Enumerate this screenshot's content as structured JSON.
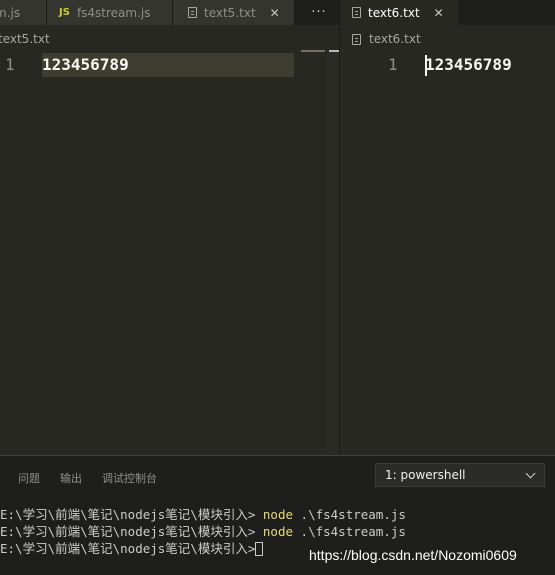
{
  "tabs_left": [
    {
      "label": "m.js",
      "type": "plain",
      "active": false
    },
    {
      "label": "fs4stream.js",
      "badge": "JS",
      "active": false
    },
    {
      "label": "text5.txt",
      "active": false,
      "close": "✕"
    }
  ],
  "more_label": "···",
  "tabs_right": [
    {
      "label": "text6.txt",
      "active": true,
      "close": "✕"
    }
  ],
  "left_editor": {
    "breadcrumb": "text5.txt",
    "line_number": "1",
    "content": "123456789"
  },
  "right_editor": {
    "breadcrumb": "text6.txt",
    "line_number": "1",
    "content": "123456789"
  },
  "panel": {
    "tabs": [
      "问题",
      "输出",
      "调试控制台"
    ],
    "terminal_select": "1: powershell",
    "lines": [
      {
        "prompt": "E:\\学习\\前端\\笔记\\nodejs笔记\\模块引入>",
        "cmd": "node",
        "args": ".\\fs4stream.js"
      },
      {
        "prompt": "E:\\学习\\前端\\笔记\\nodejs笔记\\模块引入>",
        "cmd": "node",
        "args": ".\\fs4stream.js"
      },
      {
        "prompt": "E:\\学习\\前端\\笔记\\nodejs笔记\\模块引入>",
        "cmd": "",
        "args": ""
      }
    ]
  },
  "watermark": "https://blog.csdn.net/Nozomi0609",
  "colors": {
    "editor_bg": "#272822",
    "tab_bar": "#1e1f1c",
    "command": "#e6db74"
  }
}
